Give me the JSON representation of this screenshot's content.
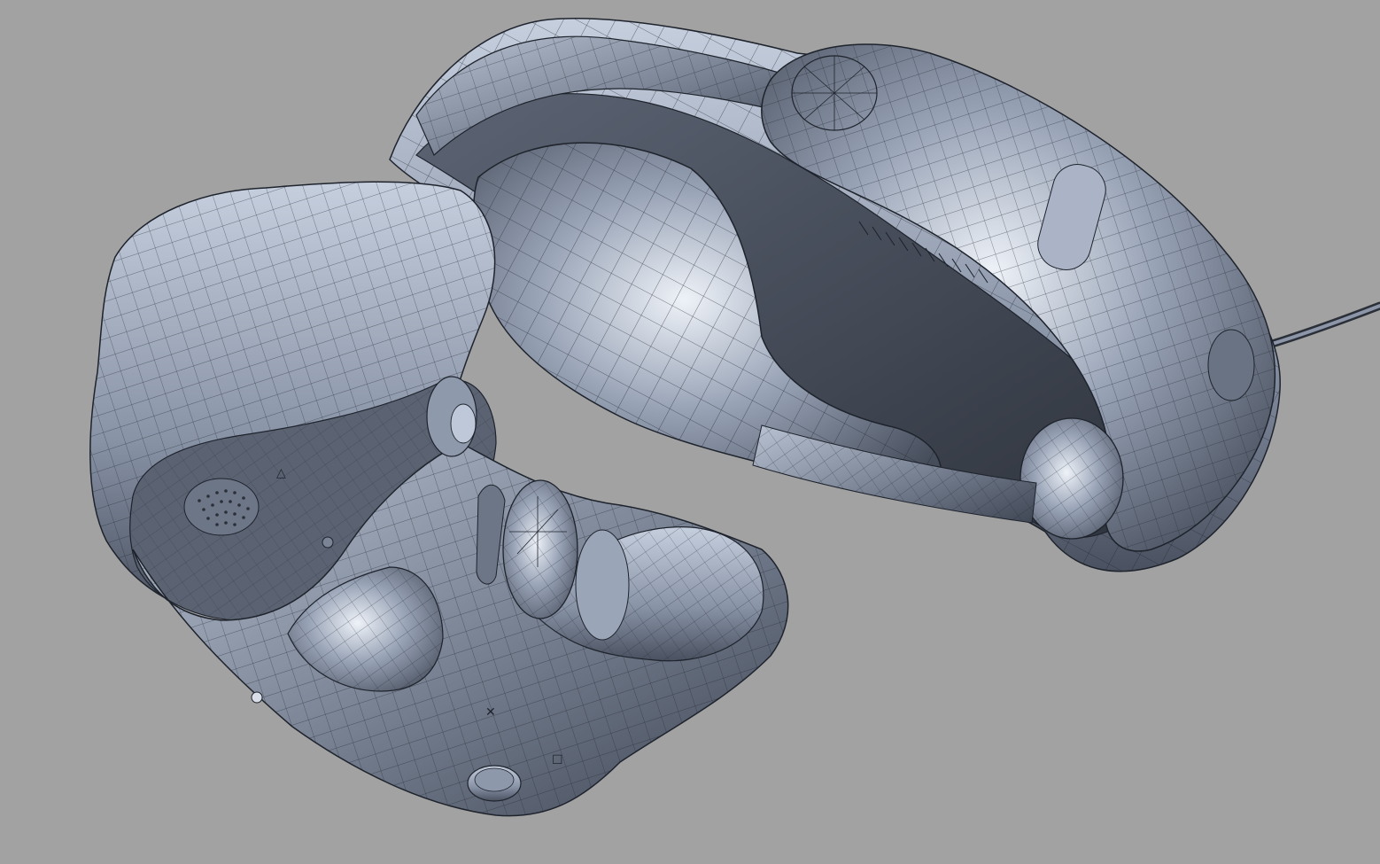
{
  "viewport": {
    "background": "#a2a2a2",
    "shaded_color": "#7d8798",
    "shadow_color": "#4a5160",
    "highlight_color": "#dfe4ee",
    "wire_color": "#1e232c"
  },
  "model": {
    "subject": "vr-headset-wireframe-model",
    "parts": [
      "headband",
      "rear-strap-pad",
      "top-strap",
      "face-plate",
      "lens-left",
      "lens-right",
      "face-cushion",
      "cable",
      "speaker-grille",
      "power-button"
    ],
    "surface_glyphs": {
      "triangle": "△",
      "cross": "✕",
      "square": "☐"
    }
  }
}
